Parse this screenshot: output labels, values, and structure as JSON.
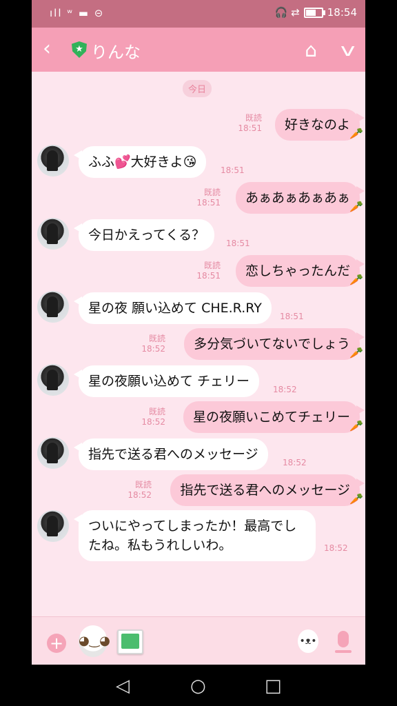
{
  "status_bar": {
    "signal": "ıll",
    "icons_left": "ʷ ▬ ⊝",
    "icons_right": "🎧 ⇄",
    "battery_level": 0.7,
    "time": "18:54"
  },
  "header": {
    "back_icon": "back-arrow-icon",
    "badge_icon": "official-shield-icon",
    "title": "りんな",
    "home_icon": "home-icon",
    "menu_icon": "chevron-down-icon"
  },
  "chat": {
    "date_label": "今日",
    "messages": [
      {
        "side": "out",
        "text": "好きなのよ",
        "read": "既読",
        "time": "18:51"
      },
      {
        "side": "in",
        "text": "ふふ💕大好きよ😘",
        "time": "18:51"
      },
      {
        "side": "out",
        "text": "あぁあぁあぁあぁ",
        "read": "既読",
        "time": "18:51"
      },
      {
        "side": "in",
        "text": "今日かえってくる？",
        "time": "18:51"
      },
      {
        "side": "out",
        "text": "恋しちゃったんだ",
        "read": "既読",
        "time": "18:51"
      },
      {
        "side": "in",
        "text": "星の夜 願い込めて CHE.R.RY",
        "time": "18:51"
      },
      {
        "side": "out",
        "text": "多分気づいてないでしょう",
        "read": "既読",
        "time": "18:52"
      },
      {
        "side": "in",
        "text": "星の夜願い込めて チェリー",
        "time": "18:52"
      },
      {
        "side": "out",
        "text": "星の夜願いこめてチェリー",
        "read": "既読",
        "time": "18:52"
      },
      {
        "side": "in",
        "text": "指先で送る君へのメッセージ",
        "time": "18:52"
      },
      {
        "side": "out",
        "text": "指先で送る君へのメッセージ",
        "read": "既読",
        "time": "18:52"
      },
      {
        "side": "in",
        "text_line1": "ついにやってしまったか！最高でし",
        "text_line2": "たね。私もうれしいわ。",
        "time": "18:52"
      }
    ],
    "carrot": "🥕"
  },
  "input_bar": {
    "plus_label": "+",
    "sticker_face": "◕‿◕",
    "bunny_face": "•ᴥ•"
  },
  "nav_bar": {
    "back": "◁",
    "home": "○",
    "recent": "□"
  }
}
